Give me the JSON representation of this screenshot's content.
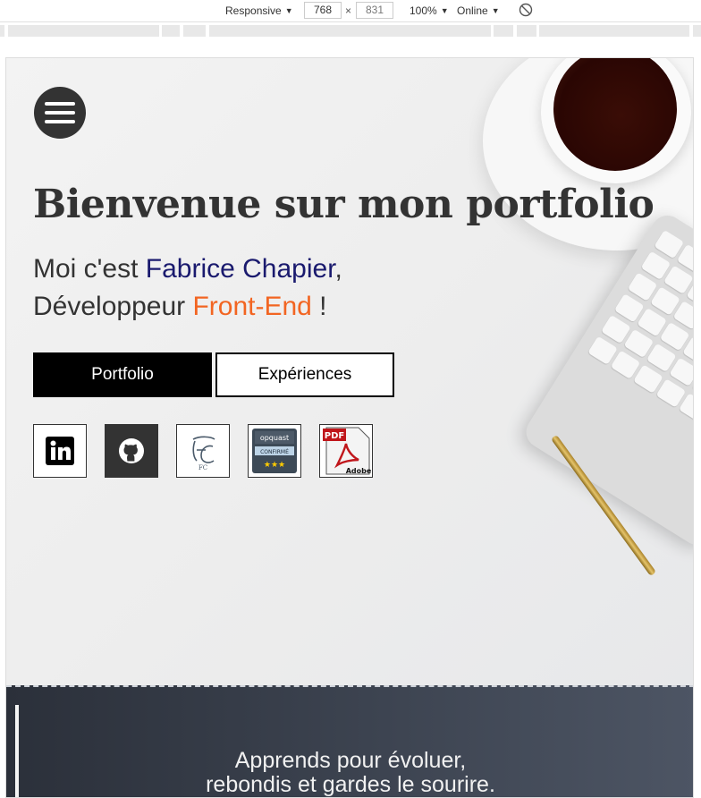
{
  "devtools": {
    "device_label": "Responsive",
    "width_value": "768",
    "height_value": "831",
    "times": "×",
    "zoom_label": "100%",
    "network_label": "Online"
  },
  "hero": {
    "title": "Bienvenue sur mon portfolio",
    "intro_prefix": "Moi c'est ",
    "name": "Fabrice Chapier",
    "intro_suffix": ",",
    "role_prefix": "Développeur ",
    "role": "Front-End",
    "role_suffix": " !",
    "buttons": {
      "portfolio": "Portfolio",
      "experiences": "Expériences"
    },
    "social": {
      "signature_text": "FC",
      "opquast_brand": "opquast",
      "opquast_level": "CONFIRMÉ",
      "opquast_stars": "★★★",
      "pdf_label": "PDF",
      "adobe_label": "Adobe"
    }
  },
  "quote": {
    "line1": "Apprends pour évoluer,",
    "line2": "rebondis et gardes le sourire."
  },
  "colors": {
    "name": "#1a1a6e",
    "role": "#f26522",
    "dark": "#333333"
  }
}
